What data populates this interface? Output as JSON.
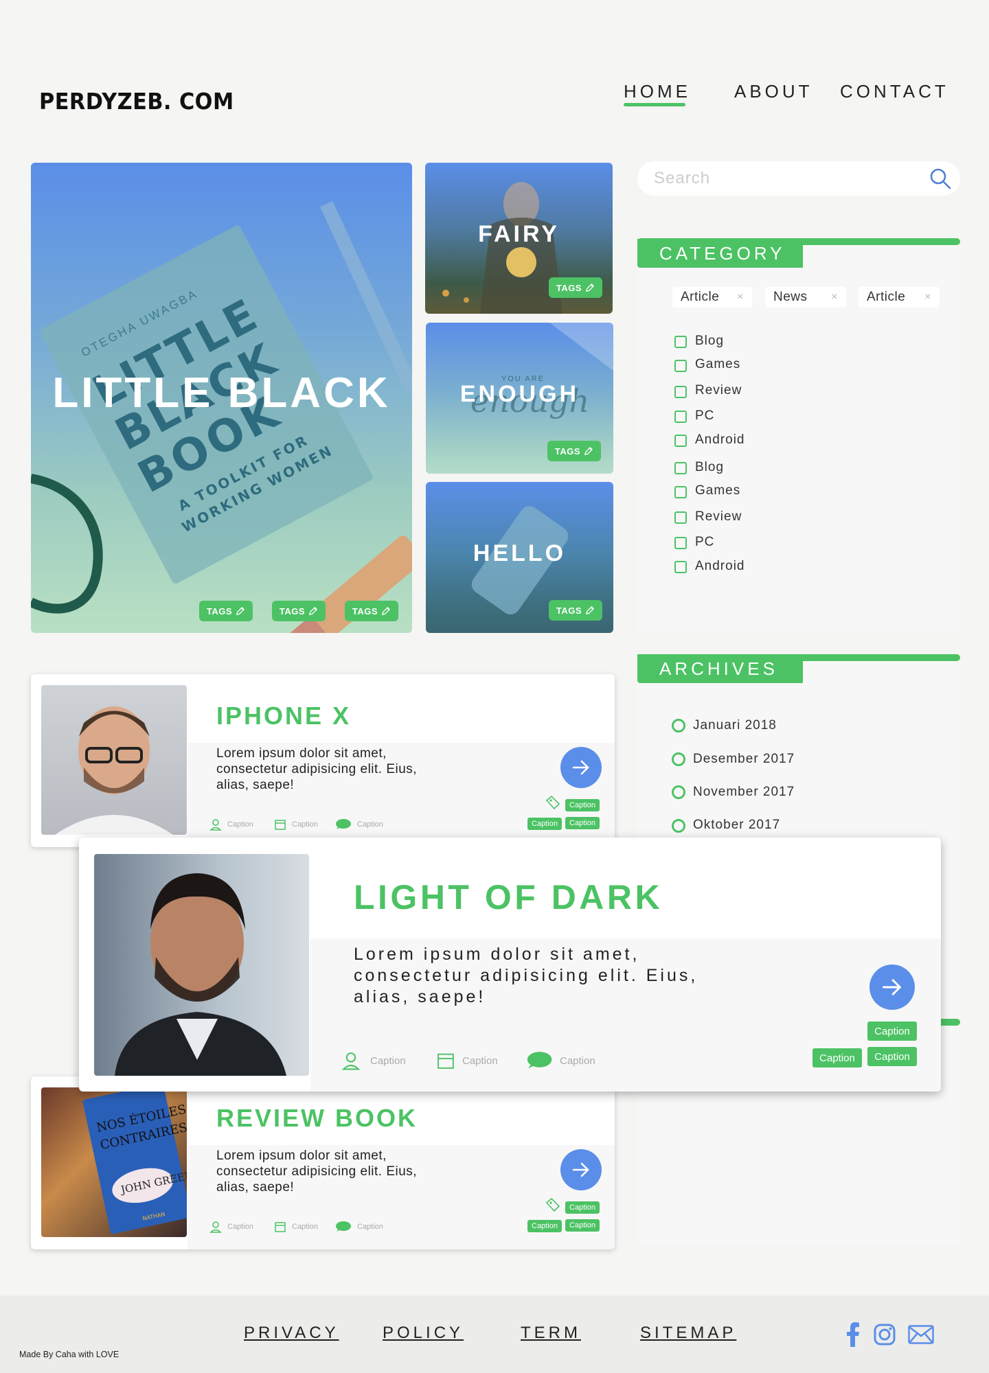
{
  "site": {
    "logo": "PERDYZEB. COM"
  },
  "nav": {
    "items": [
      "HOME",
      "ABOUT",
      "CONTACT"
    ],
    "active": "HOME"
  },
  "hero": {
    "main": {
      "title": "LITTLE BLACK",
      "tags": [
        "TAGS",
        "TAGS",
        "TAGS"
      ],
      "image_text": [
        "OTEGHA UWAGBA",
        "LITTLE",
        "BLACK",
        "BOOK",
        "A TOOLKIT FOR",
        "WORKING WOMEN"
      ]
    },
    "side": [
      {
        "title": "FAIRY",
        "tag": "TAGS"
      },
      {
        "title": "ENOUGH",
        "tag": "TAGS",
        "image_text": [
          "YOU ARE",
          "enough"
        ]
      },
      {
        "title": "HELLO",
        "tag": "TAGS"
      }
    ]
  },
  "search": {
    "placeholder": "Search"
  },
  "category": {
    "heading": "CATEGORY",
    "chips": [
      "Article",
      "News",
      "Article"
    ],
    "chip_close": "×",
    "items": [
      "Blog",
      "Games",
      "Review",
      "PC",
      "Android",
      "Blog",
      "Games",
      "Review",
      "PC",
      "Android"
    ]
  },
  "archives": {
    "heading": "ARCHIVES",
    "items": [
      "Januari 2018",
      "Desember 2017",
      "November 2017",
      "Oktober 2017"
    ]
  },
  "articles": [
    {
      "title": "IPHONE X",
      "body": [
        "Lorem ipsum dolor sit amet,",
        "consectetur adipisicing elit. Eius,",
        "alias, saepe!"
      ],
      "meta": [
        "Caption",
        "Caption",
        "Caption"
      ],
      "badges": [
        "Caption",
        "Caption",
        "Caption"
      ]
    },
    {
      "title": "LIGHT OF DARK",
      "body": [
        "Lorem ipsum dolor sit amet,",
        "consectetur adipisicing elit. Eius,",
        "alias, saepe!"
      ],
      "meta": [
        "Caption",
        "Caption",
        "Caption"
      ],
      "badges": [
        "Caption",
        "Caption",
        "Caption"
      ]
    },
    {
      "title": "REVIEW BOOK",
      "body": [
        "Lorem ipsum dolor sit amet,",
        "consectetur adipisicing elit. Eius,",
        "alias, saepe!"
      ],
      "meta": [
        "Caption",
        "Caption",
        "Caption"
      ],
      "badges": [
        "Caption",
        "Caption",
        "Caption"
      ],
      "image_text": [
        "NOS ÉTOILES",
        "CONTRAIRES",
        "JOHN GREEN",
        "NATHAN"
      ]
    }
  ],
  "footer": {
    "links": [
      "PRIVACY",
      "POLICY",
      "TERM",
      "SITEMAP"
    ],
    "credit": "Made By Caha with LOVE",
    "social_icons": [
      "facebook-icon",
      "instagram-icon",
      "mail-icon"
    ]
  },
  "colors": {
    "accent": "#4cc264",
    "button": "#5b8ee8",
    "background": "#f5f5f3"
  }
}
